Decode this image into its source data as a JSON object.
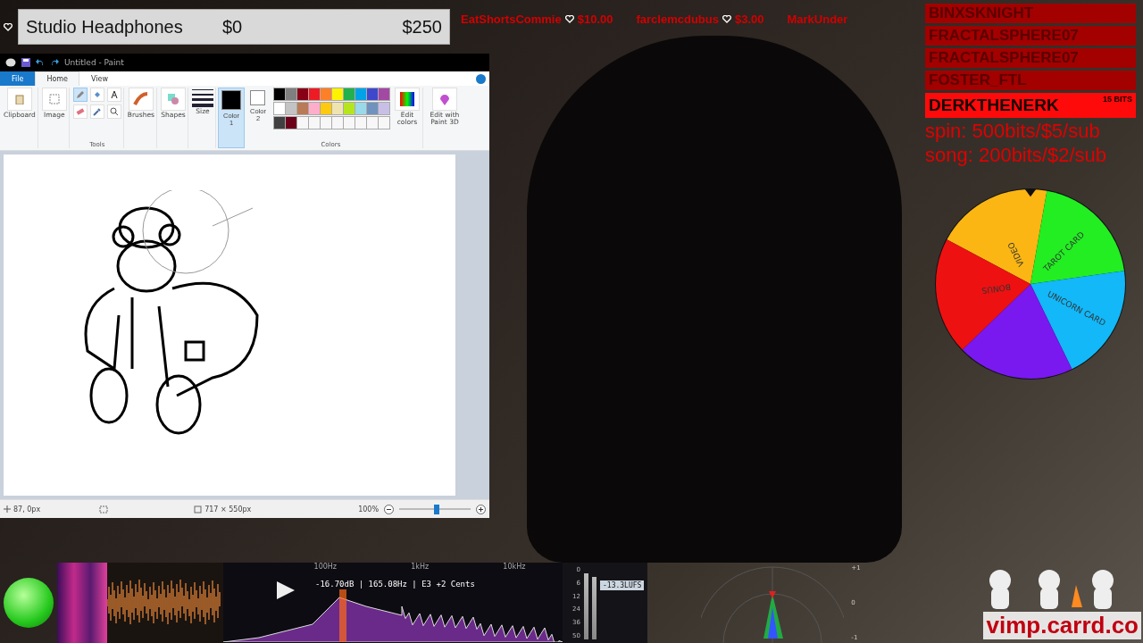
{
  "goal": {
    "title": "Studio Headphones",
    "start": "$0",
    "target": "$250"
  },
  "ticker": [
    {
      "name": "EatShortsCommie",
      "amount": "$10.00"
    },
    {
      "name": "farclemcdubus",
      "amount": "$3.00"
    },
    {
      "name": "MarkUnder"
    }
  ],
  "leaderboard": [
    {
      "name": "BINXSKNIGHT",
      "selected": false
    },
    {
      "name": "FRACTALSPHERE07",
      "selected": false
    },
    {
      "name": "FRACTALSPHERE07",
      "selected": false
    },
    {
      "name": "FOSTER_FTL",
      "selected": false
    },
    {
      "name": "DERKTHENERK",
      "tag": "15 BITS",
      "selected": true
    }
  ],
  "commands": [
    "spin: 500bits/$5/sub",
    "song: 200bits/$2/sub"
  ],
  "wheel": [
    {
      "label": "VIDEO",
      "color": "#fbb614"
    },
    {
      "label": "TAROT CARD",
      "color": "#22ee22"
    },
    {
      "label": "UNICORN CARD",
      "color": "#12b8f8"
    },
    {
      "color": "#7a18f0"
    },
    {
      "label": "BONUS",
      "color": "#ee1111"
    }
  ],
  "paint": {
    "title": "Untitled - Paint",
    "tabs": [
      {
        "label": "File",
        "selected": false,
        "kind": "file"
      },
      {
        "label": "Home",
        "selected": true,
        "kind": "tab"
      },
      {
        "label": "View",
        "selected": false,
        "kind": "tab"
      }
    ],
    "groups": {
      "clipboard": "Clipboard",
      "image": "Image",
      "tools": "Tools",
      "brushes": "Brushes",
      "shapes": "Shapes",
      "size": "Size",
      "colors": "Colors",
      "edit_colors": "Edit colors",
      "paint3d": "Edit with Paint 3D"
    },
    "color_slots": [
      {
        "label": "Color",
        "number": "1",
        "color": "#000000",
        "selected": true
      },
      {
        "label": "Color",
        "number": "2",
        "color": "#ffffff",
        "selected": false
      }
    ],
    "palette": [
      {
        "kind": "swatch",
        "color": "#000000"
      },
      {
        "kind": "swatch",
        "color": "#7f7f7f"
      },
      {
        "kind": "swatch",
        "color": "#880015"
      },
      {
        "kind": "swatch",
        "color": "#ed1c24"
      },
      {
        "kind": "swatch",
        "color": "#ff7f27"
      },
      {
        "kind": "swatch",
        "color": "#fff200"
      },
      {
        "kind": "swatch",
        "color": "#22b14c"
      },
      {
        "kind": "swatch",
        "color": "#00a2e8"
      },
      {
        "kind": "swatch",
        "color": "#3f48cc"
      },
      {
        "kind": "swatch",
        "color": "#a349a4"
      },
      {
        "kind": "swatch",
        "color": "#ffffff"
      },
      {
        "kind": "swatch",
        "color": "#c3c3c3"
      },
      {
        "kind": "swatch",
        "color": "#b97a57"
      },
      {
        "kind": "swatch",
        "color": "#ffaec9"
      },
      {
        "kind": "swatch",
        "color": "#ffc90e"
      },
      {
        "kind": "swatch",
        "color": "#efe4b0"
      },
      {
        "kind": "swatch",
        "color": "#b5e61d"
      },
      {
        "kind": "swatch",
        "color": "#99d9ea"
      },
      {
        "kind": "swatch",
        "color": "#7092be"
      },
      {
        "kind": "swatch",
        "color": "#c8bfe7"
      },
      {
        "kind": "swatch",
        "color": "#404040"
      },
      {
        "kind": "swatch",
        "color": "#6b0018"
      },
      {
        "kind": "empty"
      },
      {
        "kind": "empty"
      },
      {
        "kind": "empty"
      },
      {
        "kind": "empty"
      },
      {
        "kind": "empty"
      },
      {
        "kind": "empty"
      },
      {
        "kind": "empty"
      },
      {
        "kind": "empty"
      }
    ],
    "status": {
      "position": "87, 0px",
      "size": "717 × 550px",
      "zoom": "100%",
      "level": 0.52
    }
  },
  "audio": {
    "readout": "-16.70dB | 165.08Hz | E3  +2  Cents",
    "freq_labels": [
      "100Hz",
      "1kHz",
      "10kHz"
    ],
    "meter_ticks": [
      "0",
      "6",
      "12",
      "24",
      "36",
      "50"
    ],
    "loudness": "-13.3LUFS",
    "phase_ticks": [
      "+1",
      "0",
      "-1"
    ]
  },
  "site": "vimp.carrd.co"
}
